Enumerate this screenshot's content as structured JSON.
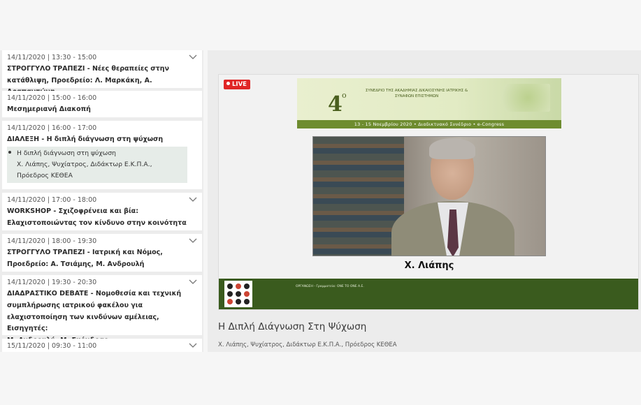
{
  "sessions": [
    {
      "datetime": "14/11/2020 | 13:30 - 15:00",
      "type": "ΣΤΡΟΓΓΥΛΟ ΤΡΑΠΕΖΙ",
      "lines": [
        "ΣΤΡΟΓΓΥΛΟ ΤΡΑΠΕΖΙ - Νέες θεραπείες στην",
        "κατάθλιψη, Προεδρείο: Λ. Μαρκάκη, Α. Αραπαντώνη"
      ]
    },
    {
      "datetime": "14/11/2020 | 15:00 - 16:00",
      "lines": [
        "Μεσημεριανή Διακοπή"
      ]
    },
    {
      "datetime": "14/11/2020 | 16:00 - 17:00",
      "lines": [
        "ΔΙΑΛΕΞΗ - Η διπλή διάγνωση στη ψύχωση"
      ],
      "sub": [
        "Η διπλή διάγνωση στη ψύχωση",
        "Χ. Λιάπης, Ψυχίατρος, Διδάκτωρ Ε.Κ.Π.Α.,",
        "Πρόεδρος ΚΕΘΕΑ"
      ]
    },
    {
      "datetime": "14/11/2020 | 17:00 - 18:00",
      "lines": [
        "WORKSHOP - Σχιζοφρένεια και βία:",
        "Ελαχιστοποιώντας τον κίνδυνο στην κοινότητα"
      ]
    },
    {
      "datetime": "14/11/2020 | 18:00 - 19:30",
      "lines": [
        "ΣΤΡΟΓΓΥΛΟ ΤΡΑΠΕΖΙ - Ιατρική και Νόμος,",
        "Προεδρείο: Α. Τσιάμης, Μ. Ανδρουλή"
      ]
    },
    {
      "datetime": "14/11/2020 | 19:30 - 20:30",
      "lines": [
        "ΔΙΑΔΡΑΣΤΙΚΟ DEBATE - Νομοθεσία και τεχνική",
        "συμπλήρωσης ιατρικού φακέλου για",
        "ελαχιστοποίηση των κινδύνων αμέλειας, Εισηγητές:",
        "Μ. Ανδρουλή, Μ. Σκόνδρας"
      ]
    },
    {
      "datetime": "15/11/2020 | 09:30 - 11:00",
      "lines": []
    }
  ],
  "player": {
    "live_label": "LIVE",
    "banner_number": "4",
    "banner_sup": "ο",
    "banner_text": "ΣΥΝΕΔΡΙΟ ΤΗΣ ΑΚΑΔΗΜΙΑΣ ΔΙΚΑΙΟΣΥΝΗΣ ΙΑΤΡΙΚΗΣ & ΣΥΝΑΦΩΝ ΕΠΙΣΤΗΜΩΝ",
    "banner_strip": "13 - 15 Νοεμβρίου 2020  •  Διαδικτυακό Συνέδριο  •  e-Congress",
    "speaker_name": "Χ. Λιάπης",
    "footer_text": "ΟΡΓΑΝΩΣΗ - Γραμματεία: ONE TO ONE A.E."
  },
  "video": {
    "title": "Η Διπλή Διάγνωση Στη Ψύχωση",
    "subtitle": "Χ. Λιάπης, Ψυχίατρος, Διδάκτωρ Ε.Κ.Π.Α., Πρόεδρος ΚΕΘΕΑ"
  },
  "icons": {
    "chevron": "chevron-down-icon",
    "live_dot": "live-dot-icon"
  },
  "colors": {
    "live": "#e02626",
    "banner_green": "#6e8c2f",
    "footer_green": "#3a5b1e",
    "highlight": "#e6ece8"
  }
}
